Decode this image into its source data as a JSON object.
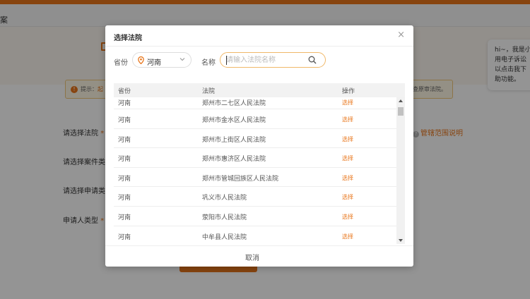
{
  "background": {
    "header_title": "案",
    "tip": {
      "prefix": "提示：",
      "text": "起",
      "suffix": "请查原审法院。"
    },
    "form_labels": {
      "court": "请选择法院",
      "case_type": "请选择案件类型",
      "apply_type": "请选择申请类型",
      "applicant_type": "申请人类型"
    },
    "required_mark": "*",
    "scope_link": "管辖范围说明",
    "scope_icon": "?",
    "chat": {
      "lines": [
        "hi~，我是小",
        "用电子诉讼",
        "以点击我下",
        "助功能。"
      ]
    },
    "colors": {
      "accent": "#e8751a"
    }
  },
  "modal": {
    "title": "选择法院",
    "close_glyph": "×",
    "province_label": "省份",
    "province_value": "河南",
    "name_label": "名称",
    "search_placeholder": "请输入法院名称",
    "table": {
      "headers": [
        "省份",
        "法院",
        "操作"
      ],
      "rows": [
        {
          "province": "河南",
          "court": "郑州市二七区人民法院",
          "action": "选择"
        },
        {
          "province": "河南",
          "court": "郑州市金水区人民法院",
          "action": "选择"
        },
        {
          "province": "河南",
          "court": "郑州市上街区人民法院",
          "action": "选择"
        },
        {
          "province": "河南",
          "court": "郑州市惠济区人民法院",
          "action": "选择"
        },
        {
          "province": "河南",
          "court": "郑州市管城回族区人民法院",
          "action": "选择"
        },
        {
          "province": "河南",
          "court": "巩义市人民法院",
          "action": "选择"
        },
        {
          "province": "河南",
          "court": "荥阳市人民法院",
          "action": "选择"
        },
        {
          "province": "河南",
          "court": "中牟县人民法院",
          "action": "选择"
        }
      ]
    },
    "cancel_label": "取消"
  }
}
